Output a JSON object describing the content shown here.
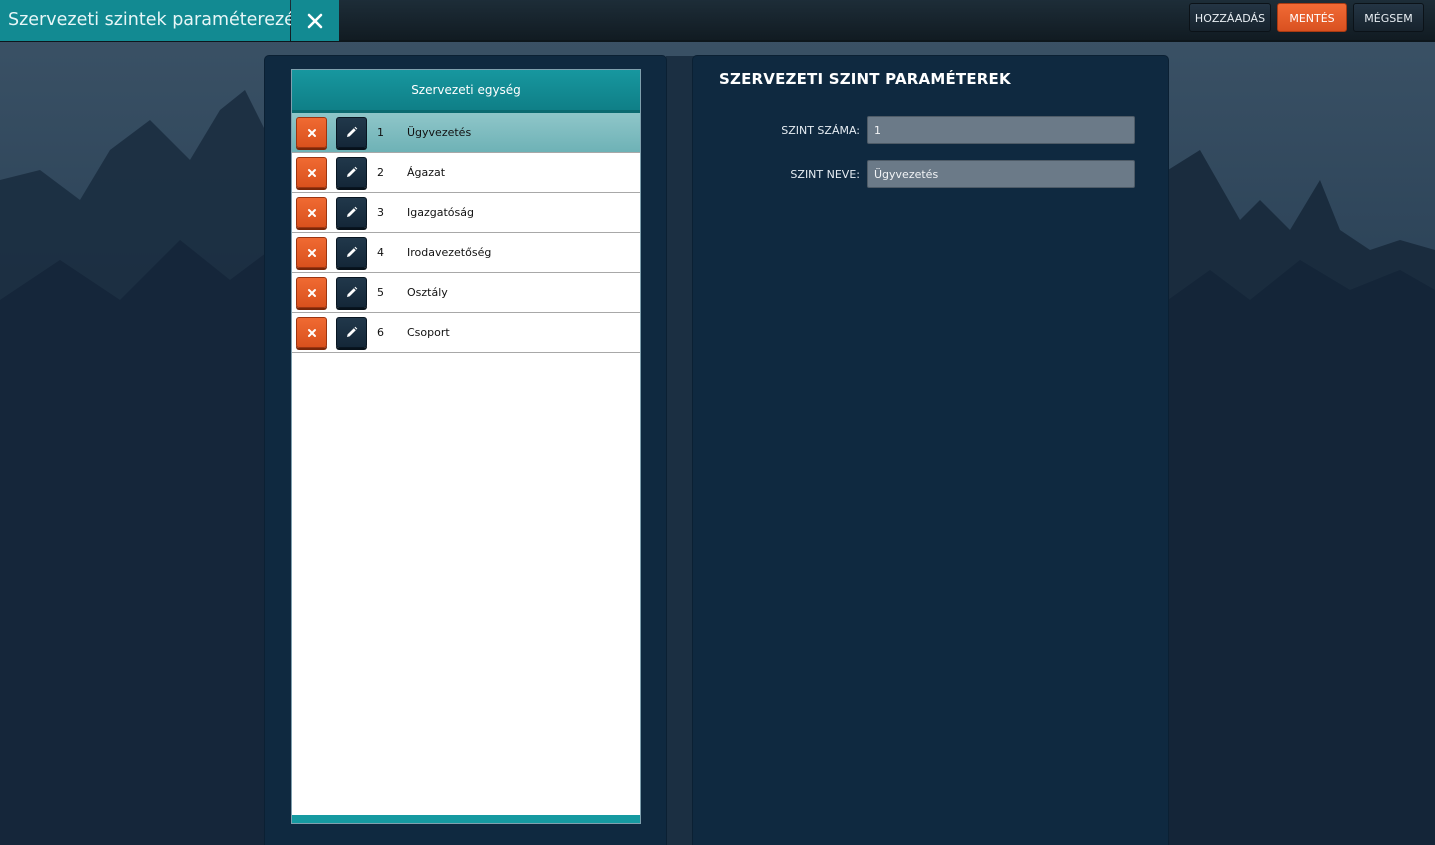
{
  "window": {
    "title": "Szervezeti szintek paraméterezése"
  },
  "toolbar": {
    "add_label": "HOZZÁADÁS",
    "save_label": "MENTÉS",
    "cancel_label": "MÉGSEM"
  },
  "grid": {
    "header": "Szervezeti egység",
    "rows": [
      {
        "number": "1",
        "name": "Ügyvezetés",
        "selected": true
      },
      {
        "number": "2",
        "name": "Ágazat"
      },
      {
        "number": "3",
        "name": "Igazgatóság"
      },
      {
        "number": "4",
        "name": "Irodavezetőség"
      },
      {
        "number": "5",
        "name": "Osztály"
      },
      {
        "number": "6",
        "name": "Csoport"
      }
    ]
  },
  "form": {
    "title": "SZERVEZETI SZINT PARAMÉTEREK",
    "level_number_label": "SZINT SZÁMA:",
    "level_number_value": "1",
    "level_name_label": "SZINT NEVE:",
    "level_name_value": "Ügyvezetés"
  },
  "colors": {
    "accent_teal": "#128a92",
    "button_orange": "#e85e28",
    "panel_bg": "#0f2940"
  },
  "icons": {
    "close": "close-icon",
    "delete": "delete-x-icon",
    "edit": "pencil-icon"
  }
}
